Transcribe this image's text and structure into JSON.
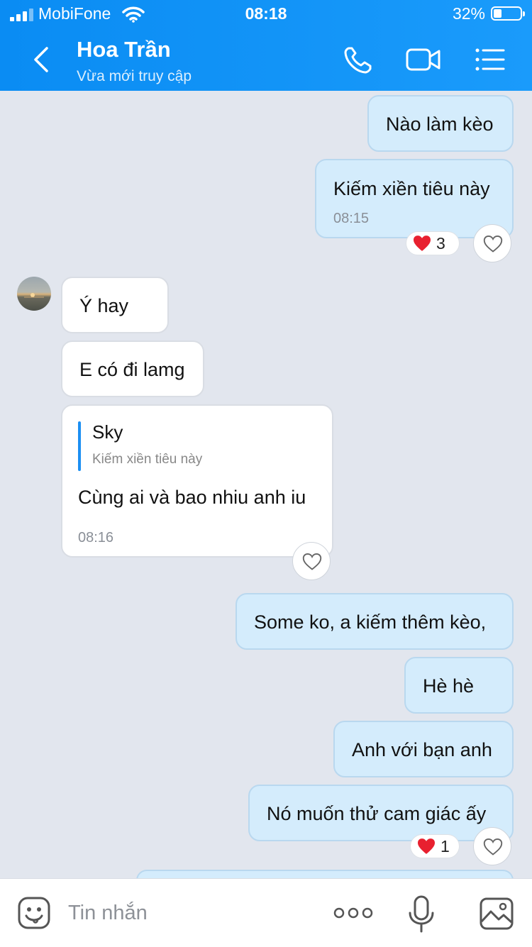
{
  "status_bar": {
    "carrier": "MobiFone",
    "time": "08:18",
    "battery": "32%"
  },
  "header": {
    "name": "Hoa Trần",
    "status": "Vừa mới truy cập"
  },
  "messages": [
    {
      "from": "me",
      "text": "Nào làm kèo"
    },
    {
      "from": "me",
      "text": "Kiếm xiền tiêu này",
      "time": "08:15",
      "reaction_count": "3"
    },
    {
      "from": "them",
      "text": "Ý hay"
    },
    {
      "from": "them",
      "text": "E có đi lamg"
    },
    {
      "from": "them",
      "quote_name": "Sky",
      "quote_text": "Kiếm xiền tiêu này",
      "text": "Cùng ai và bao nhiu anh iu",
      "time": "08:16"
    },
    {
      "from": "me",
      "text": "Some ko, a kiếm thêm kèo,"
    },
    {
      "from": "me",
      "text": "Hè hè"
    },
    {
      "from": "me",
      "text": "Anh với bạn anh"
    },
    {
      "from": "me",
      "text": "Nó muốn thử cam giác ấy",
      "reaction_count": "1"
    }
  ],
  "composer": {
    "placeholder": "Tin nhắn"
  },
  "colors": {
    "header": "#1a9bfb",
    "outgoing_bubble": "#d4ecfc",
    "incoming_bubble": "#ffffff",
    "chat_background": "#e2e6ee",
    "heart": "#e8202f"
  }
}
